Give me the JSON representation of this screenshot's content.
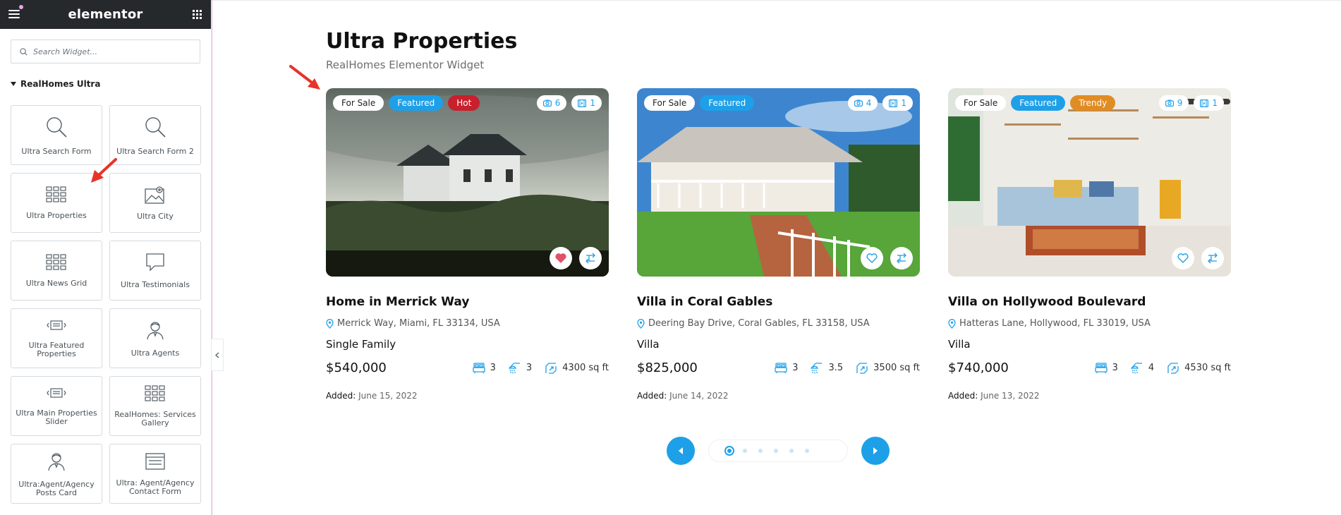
{
  "app": {
    "logo": "elementor"
  },
  "search": {
    "placeholder": "Search Widget..."
  },
  "category": {
    "label": "RealHomes Ultra"
  },
  "widgets": [
    {
      "label": "Ultra Search Form",
      "icon": "search-icon"
    },
    {
      "label": "Ultra Search Form 2",
      "icon": "search-icon"
    },
    {
      "label": "Ultra Properties",
      "icon": "grid-icon"
    },
    {
      "label": "Ultra City",
      "icon": "map-image-icon"
    },
    {
      "label": "Ultra News Grid",
      "icon": "grid-icon"
    },
    {
      "label": "Ultra Testimonials",
      "icon": "speech-bubble-icon"
    },
    {
      "label": "Ultra Featured Properties",
      "icon": "slider-icon"
    },
    {
      "label": "Ultra Agents",
      "icon": "agent-icon"
    },
    {
      "label": "Ultra Main Properties Slider",
      "icon": "slider-icon"
    },
    {
      "label": "RealHomes: Services Gallery",
      "icon": "grid-icon"
    },
    {
      "label": "Ultra:Agent/Agency Posts Card",
      "icon": "agent-icon"
    },
    {
      "label": "Ultra: Agent/Agency Contact Form",
      "icon": "form-icon"
    }
  ],
  "page": {
    "title": "Ultra Properties",
    "subtitle": "RealHomes Elementor Widget"
  },
  "properties": [
    {
      "tags": [
        "For Sale",
        "Featured",
        "Hot"
      ],
      "photos": "6",
      "videos": "1",
      "favorited": true,
      "title": "Home in Merrick Way",
      "address": "Merrick Way, Miami, FL 33134, USA",
      "type": "Single Family",
      "price": "$540,000",
      "beds": "3",
      "baths": "3",
      "area": "4300",
      "area_unit": "sq ft",
      "added_label": "Added:",
      "added_date": "June 15, 2022"
    },
    {
      "tags": [
        "For Sale",
        "Featured"
      ],
      "photos": "4",
      "videos": "1",
      "favorited": false,
      "title": "Villa in Coral Gables",
      "address": "Deering Bay Drive, Coral Gables, FL 33158, USA",
      "type": "Villa",
      "price": "$825,000",
      "beds": "3",
      "baths": "3.5",
      "area": "3500",
      "area_unit": "sq ft",
      "added_label": "Added:",
      "added_date": "June 14, 2022"
    },
    {
      "tags": [
        "For Sale",
        "Featured",
        "Trendy"
      ],
      "photos": "9",
      "videos": "1",
      "favorited": false,
      "title": "Villa on Hollywood Boulevard",
      "address": "Hatteras Lane, Hollywood, FL 33019, USA",
      "type": "Villa",
      "price": "$740,000",
      "beds": "3",
      "baths": "4",
      "area": "4530",
      "area_unit": "sq ft",
      "added_label": "Added:",
      "added_date": "June 13, 2022"
    }
  ],
  "pagination": {
    "pages": 6,
    "active": 1
  },
  "colors": {
    "accent": "#1ea0e8",
    "hot": "#c8202c",
    "trendy": "#e08c25",
    "topbar": "#26292c",
    "arrow": "#e8332a"
  }
}
